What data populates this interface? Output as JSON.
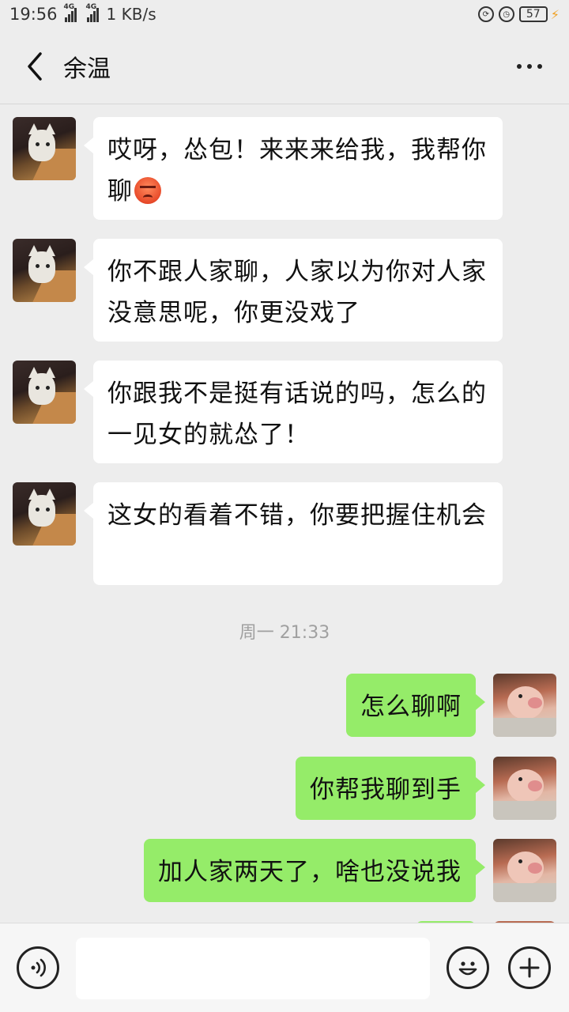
{
  "status_bar": {
    "time": "19:56",
    "signal_1_tag": "4G",
    "signal_2_tag": "4G",
    "net_speed": "1 KB/s",
    "battery": "57",
    "icons": [
      "sync-lock-icon",
      "alarm-icon",
      "battery-icon",
      "charging-icon"
    ]
  },
  "header": {
    "title": "余温",
    "back_icon": "chevron-left-icon",
    "more_icon": "more-dots-icon"
  },
  "messages": [
    {
      "side": "left",
      "avatar": "cat-avatar",
      "text": "哎呀，怂包！来来来给我，我帮你聊",
      "emoji": "angry-face"
    },
    {
      "side": "left",
      "avatar": "cat-avatar",
      "text": "你不跟人家聊，人家以为你对人家没意思呢，你更没戏了"
    },
    {
      "side": "left",
      "avatar": "cat-avatar",
      "text": "你跟我不是挺有话说的吗，怎么的一见女的就怂了！"
    },
    {
      "side": "left",
      "avatar": "cat-avatar",
      "text": "这女的看着不错，你要把握住机会"
    },
    {
      "side": "right",
      "avatar": "pig-avatar",
      "text": "怎么聊啊"
    },
    {
      "side": "right",
      "avatar": "pig-avatar",
      "text": "你帮我聊到手"
    },
    {
      "side": "right",
      "avatar": "pig-avatar",
      "text": "加人家两天了，啥也没说我"
    }
  ],
  "timestamp": "周一 21:33",
  "input_bar": {
    "value": "",
    "voice_icon": "voice-icon",
    "emoji_icon": "emoji-icon",
    "plus_icon": "plus-icon"
  },
  "colors": {
    "background": "#ededed",
    "bubble_left": "#ffffff",
    "bubble_right": "#95ec69",
    "timestamp": "#a0a0a0"
  }
}
